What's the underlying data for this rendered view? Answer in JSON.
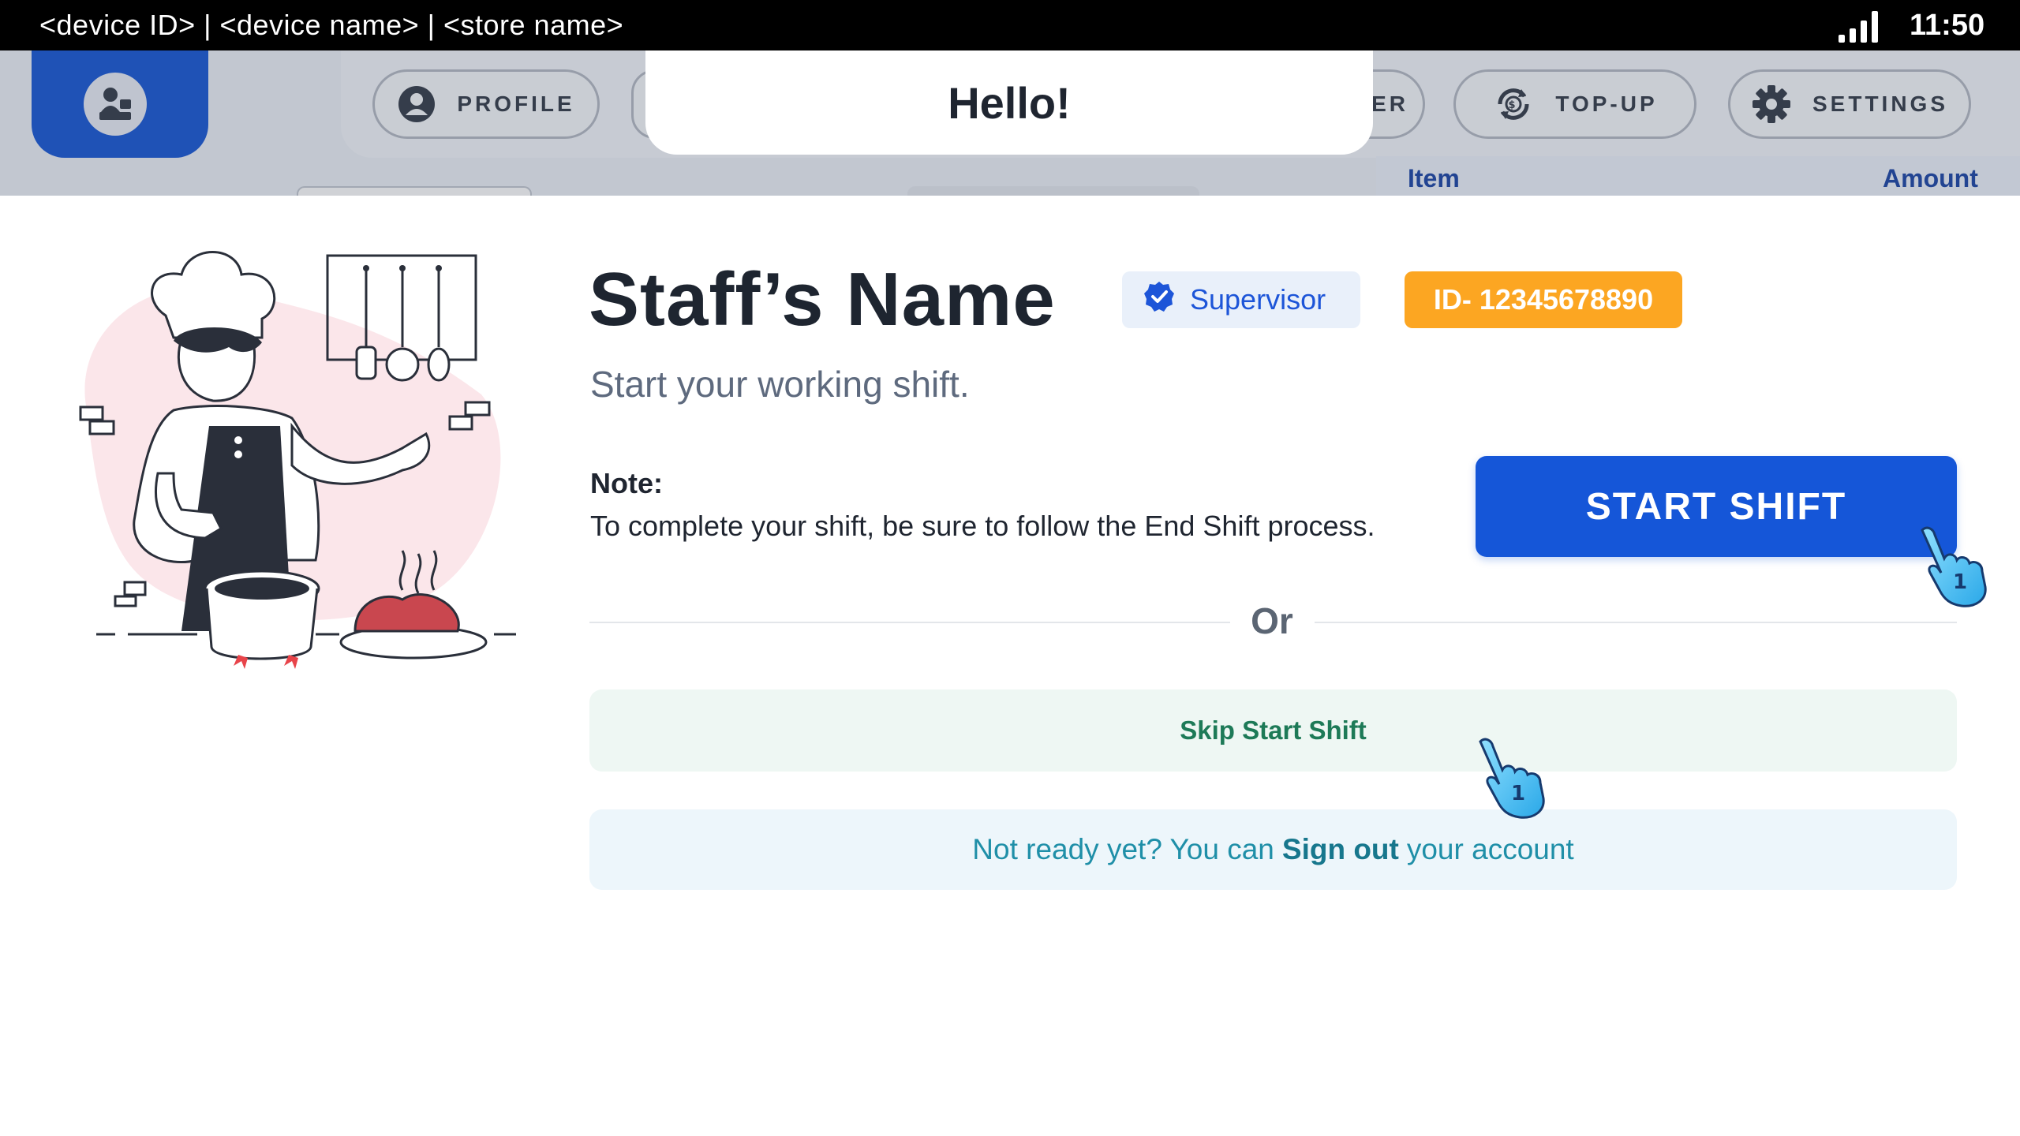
{
  "status_bar": {
    "device_info": "<device ID> | <device name> | <store name>",
    "time": "11:50",
    "signal_icon": "signal-bars-icon"
  },
  "background_app": {
    "nav": {
      "profile_label": "PROFILE",
      "order_label_fragment": "DER",
      "topup_label": "TOP-UP",
      "settings_label": "SETTINGS"
    },
    "order_table": {
      "item_header": "Item",
      "amount_header": "Amount"
    }
  },
  "banner": {
    "greeting": "Hello!"
  },
  "staff": {
    "name": "Staff’s Name",
    "role": "Supervisor",
    "id": "ID- 12345678890",
    "subtitle": "Start your working shift."
  },
  "note": {
    "label": "Note:",
    "text": "To complete your shift, be sure to follow the End Shift process."
  },
  "actions": {
    "start_shift": "START SHIFT",
    "or": "Or",
    "skip_start_shift": "Skip Start Shift",
    "signout_prefix": "Not ready yet? You can",
    "signout_link": "Sign out",
    "signout_suffix": "your account"
  },
  "tap_hints": [
    "1",
    "1"
  ],
  "colors": {
    "primary": "#1556d8",
    "id_badge": "#fca622",
    "skip_text": "#1d7a57",
    "signout_text": "#1f8fa8"
  }
}
